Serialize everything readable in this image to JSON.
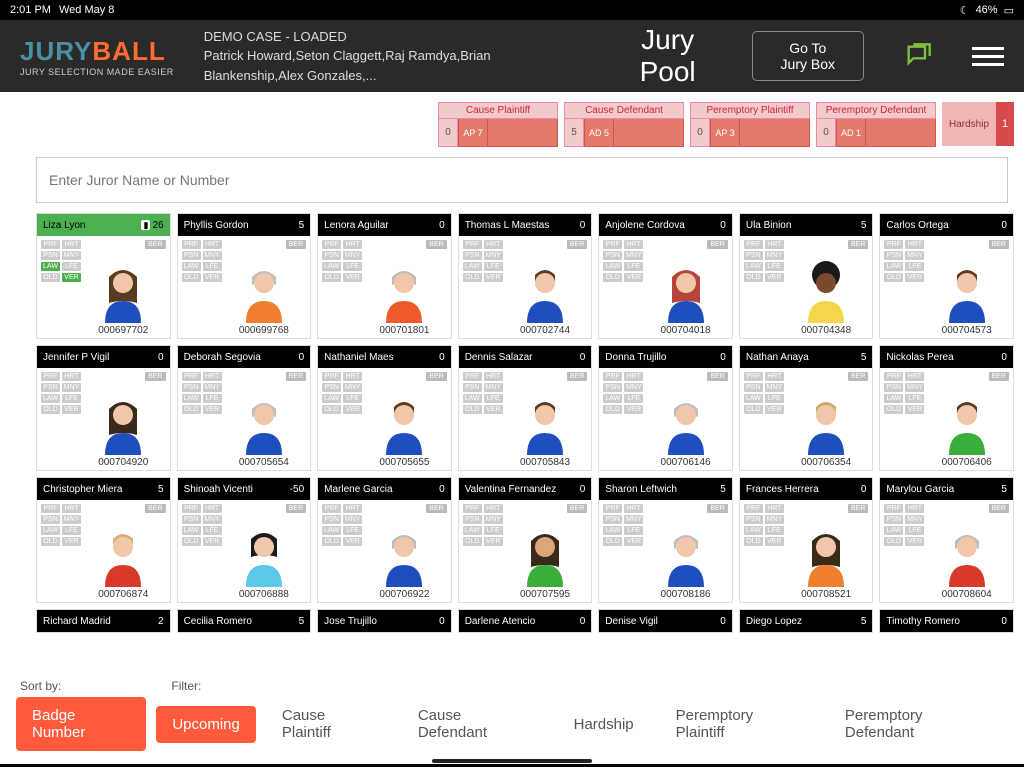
{
  "status": {
    "time": "2:01 PM",
    "date": "Wed May 8",
    "moon": "☾",
    "battery_pct": "46%",
    "battery_icon": "▭"
  },
  "logo": {
    "jury": "JURY",
    "ball": "BALL",
    "tag": "JURY SELECTION MADE EASIER"
  },
  "case": {
    "title": "DEMO CASE - LOADED",
    "attys": "Patrick Howard,Seton Claggett,Raj Ramdya,Brian Blankenship,Alex Gonzales,..."
  },
  "page_title": "Jury Pool",
  "jurybox": {
    "l1": "Go To",
    "l2": "Jury Box"
  },
  "dismiss": [
    {
      "label": "Cause Plaintiff",
      "count": "0",
      "ap": "AP 7"
    },
    {
      "label": "Cause Defendant",
      "count": "5",
      "ap": "AD 5"
    },
    {
      "label": "Peremptory Plaintiff",
      "count": "0",
      "ap": "AP 3"
    },
    {
      "label": "Peremptory Defendant",
      "count": "0",
      "ap": "AD 1"
    }
  ],
  "hardship": {
    "label": "Hardship",
    "count": "1"
  },
  "search_placeholder": "Enter Juror Name or Number",
  "tag_labels": [
    "PRF",
    "HRT",
    "PSN",
    "MNY",
    "LAW",
    "LFE",
    "OLD",
    "VER"
  ],
  "ber": "BER",
  "jurors": [
    {
      "name": "Liza Lyon",
      "score": "26",
      "id": "000697702",
      "hdr": "green",
      "doc": true,
      "av": {
        "skin": "#f2c7a9",
        "hair": "#5a3b1f",
        "shirt": "#1f4fbf",
        "hs": "long"
      },
      "greentags": true
    },
    {
      "name": "Phyllis Gordon",
      "score": "5",
      "id": "000699768",
      "hdr": "black",
      "av": {
        "skin": "#f2c7a9",
        "hair": "#bdbdbd",
        "shirt": "#f07f2e",
        "hs": "short"
      }
    },
    {
      "name": "Lenora Aguilar",
      "score": "0",
      "id": "000701801",
      "hdr": "black",
      "av": {
        "skin": "#f2c7a9",
        "hair": "#bdbdbd",
        "shirt": "#ef5a2a",
        "hs": "short"
      }
    },
    {
      "name": "Thomas L Maestas",
      "score": "0",
      "id": "000702744",
      "hdr": "black",
      "av": {
        "skin": "#f2c7a9",
        "hair": "#5a3b1f",
        "shirt": "#1f4fbf",
        "hs": "male"
      }
    },
    {
      "name": "Anjolene Cordova",
      "score": "0",
      "id": "000704018",
      "hdr": "black",
      "av": {
        "skin": "#f2c7a9",
        "hair": "#b8433a",
        "shirt": "#1f4fbf",
        "hs": "long"
      }
    },
    {
      "name": "Ula Binion",
      "score": "5",
      "id": "000704348",
      "hdr": "black",
      "av": {
        "skin": "#7a4a2f",
        "hair": "#1a1a1a",
        "shirt": "#f5d54a",
        "hs": "afro"
      }
    },
    {
      "name": "Carlos Ortega",
      "score": "0",
      "id": "000704573",
      "hdr": "black",
      "av": {
        "skin": "#f2c7a9",
        "hair": "#5a3b1f",
        "shirt": "#1f4fbf",
        "hs": "male"
      }
    },
    {
      "name": "Jennifer P Vigil",
      "score": "0",
      "id": "000704920",
      "hdr": "black",
      "av": {
        "skin": "#f2c7a9",
        "hair": "#3a2a1a",
        "shirt": "#1f4fbf",
        "hs": "long"
      }
    },
    {
      "name": "Deborah Segovia",
      "score": "0",
      "id": "000705654",
      "hdr": "black",
      "av": {
        "skin": "#f2c7a9",
        "hair": "#bdbdbd",
        "shirt": "#1f4fbf",
        "hs": "short"
      }
    },
    {
      "name": "Nathaniel Maes",
      "score": "0",
      "id": "000705655",
      "hdr": "black",
      "av": {
        "skin": "#f2c7a9",
        "hair": "#5a3b1f",
        "shirt": "#1f4fbf",
        "hs": "male"
      }
    },
    {
      "name": "Dennis Salazar",
      "score": "0",
      "id": "000705843",
      "hdr": "black",
      "av": {
        "skin": "#f2c7a9",
        "hair": "#5a3b1f",
        "shirt": "#1f4fbf",
        "hs": "male"
      }
    },
    {
      "name": "Donna Trujillo",
      "score": "0",
      "id": "000706146",
      "hdr": "black",
      "av": {
        "skin": "#f2c7a9",
        "hair": "#bdbdbd",
        "shirt": "#1f4fbf",
        "hs": "short"
      }
    },
    {
      "name": "Nathan Anaya",
      "score": "5",
      "id": "000706354",
      "hdr": "black",
      "av": {
        "skin": "#f2c7a9",
        "hair": "#cfa86a",
        "shirt": "#1f4fbf",
        "hs": "male"
      }
    },
    {
      "name": "Nickolas Perea",
      "score": "0",
      "id": "000706406",
      "hdr": "black",
      "av": {
        "skin": "#f2c7a9",
        "hair": "#5a3b1f",
        "shirt": "#3aad3a",
        "hs": "male"
      }
    },
    {
      "name": "Christopher Miera",
      "score": "5",
      "id": "000706874",
      "hdr": "black",
      "av": {
        "skin": "#f2c7a9",
        "hair": "#d9b074",
        "shirt": "#d83a2a",
        "hs": "male"
      }
    },
    {
      "name": "Shinoah Vicenti",
      "score": "-50",
      "id": "000706888",
      "hdr": "black",
      "av": {
        "skin": "#f2c7a9",
        "hair": "#1a1a1a",
        "shirt": "#5ac8e8",
        "hs": "bob"
      }
    },
    {
      "name": "Marlene Garcia",
      "score": "0",
      "id": "000706922",
      "hdr": "black",
      "av": {
        "skin": "#f2c7a9",
        "hair": "#bdbdbd",
        "shirt": "#1f4fbf",
        "hs": "short"
      }
    },
    {
      "name": "Valentina Fernandez",
      "score": "0",
      "id": "000707595",
      "hdr": "black",
      "av": {
        "skin": "#d9a77a",
        "hair": "#3a2a1a",
        "shirt": "#3aad3a",
        "hs": "long"
      }
    },
    {
      "name": "Sharon Leftwich",
      "score": "5",
      "id": "000708186",
      "hdr": "black",
      "av": {
        "skin": "#f2c7a9",
        "hair": "#bdbdbd",
        "shirt": "#1f4fbf",
        "hs": "short"
      }
    },
    {
      "name": "Frances Herrera",
      "score": "0",
      "id": "000708521",
      "hdr": "black",
      "av": {
        "skin": "#f2c7a9",
        "hair": "#3a2a1a",
        "shirt": "#f07f2e",
        "hs": "long"
      }
    },
    {
      "name": "Marylou Garcia",
      "score": "5",
      "id": "000708604",
      "hdr": "black",
      "av": {
        "skin": "#f2c7a9",
        "hair": "#bdbdbd",
        "shirt": "#d83a2a",
        "hs": "short"
      }
    },
    {
      "name": "Richard Madrid",
      "score": "2",
      "id": "",
      "hdr": "black",
      "short": true
    },
    {
      "name": "Cecilia Romero",
      "score": "5",
      "id": "",
      "hdr": "black",
      "short": true
    },
    {
      "name": "Jose Trujillo",
      "score": "0",
      "id": "",
      "hdr": "black",
      "short": true
    },
    {
      "name": "Darlene Atencio",
      "score": "0",
      "id": "",
      "hdr": "black",
      "short": true
    },
    {
      "name": "Denise Vigil",
      "score": "0",
      "id": "",
      "hdr": "black",
      "short": true
    },
    {
      "name": "Diego Lopez",
      "score": "5",
      "id": "",
      "hdr": "black",
      "short": true
    },
    {
      "name": "Timothy Romero",
      "score": "0",
      "id": "",
      "hdr": "black",
      "short": true
    }
  ],
  "footer": {
    "sort_label": "Sort by:",
    "filter_label": "Filter:",
    "badge": "Badge Number",
    "upcoming": "Upcoming",
    "filters": [
      "Cause Plaintiff",
      "Cause Defendant",
      "Hardship",
      "Peremptory Plaintiff",
      "Peremptory Defendant"
    ]
  }
}
